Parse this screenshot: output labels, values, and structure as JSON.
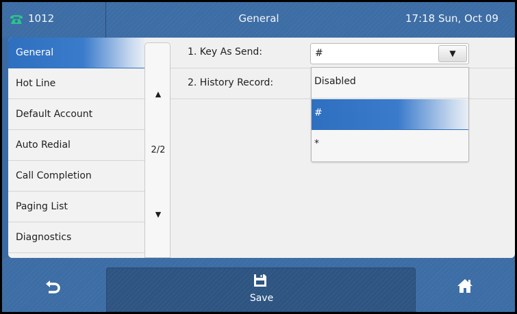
{
  "status_bar": {
    "line_number": "1012",
    "title": "General",
    "clock": "17:18 Sun, Oct 09",
    "phone_icon": "phone-handset-icon",
    "accent_color": "#2bc48a"
  },
  "menu": {
    "items": [
      {
        "label": "General",
        "selected": true
      },
      {
        "label": "Hot Line",
        "selected": false
      },
      {
        "label": "Default Account",
        "selected": false
      },
      {
        "label": "Auto Redial",
        "selected": false
      },
      {
        "label": "Call Completion",
        "selected": false
      },
      {
        "label": "Paging List",
        "selected": false
      },
      {
        "label": "Diagnostics",
        "selected": false
      }
    ],
    "selected_color": "#2f6fbf"
  },
  "scroller": {
    "up_arrow": "▲",
    "page_indicator": "2/2",
    "down_arrow": "▼"
  },
  "settings": {
    "rows": [
      {
        "label": "1. Key As Send:",
        "value": "#"
      },
      {
        "label": "2. History Record:",
        "value": ""
      }
    ],
    "dropdown_arrow": "▼"
  },
  "dropdown": {
    "options": [
      {
        "label": "Disabled",
        "selected": false
      },
      {
        "label": "#",
        "selected": true
      },
      {
        "label": "*",
        "selected": false
      }
    ]
  },
  "softkeys": {
    "back_icon": "back-arrow-icon",
    "save_icon": "floppy-disk-icon",
    "save_label": "Save",
    "home_icon": "home-icon"
  }
}
